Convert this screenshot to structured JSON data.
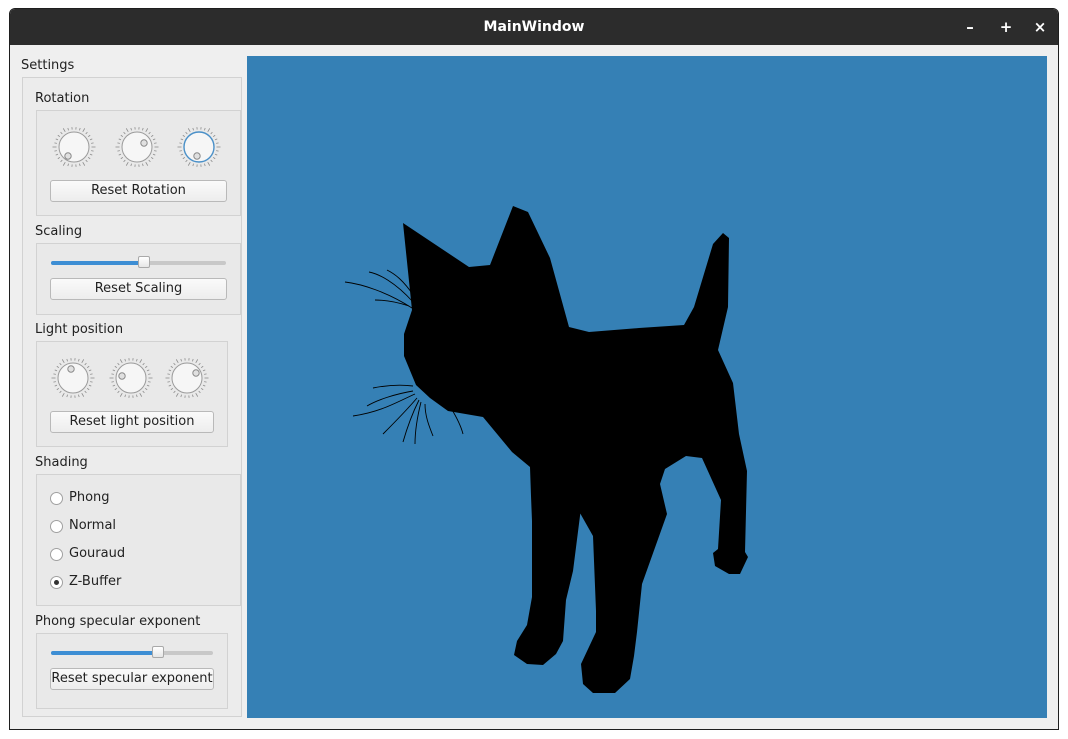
{
  "window": {
    "title": "MainWindow",
    "minimize": "–",
    "maximize": "+",
    "close": "×"
  },
  "settings": {
    "title": "Settings",
    "rotation": {
      "title": "Rotation",
      "reset_label": "Reset Rotation"
    },
    "scaling": {
      "title": "Scaling",
      "reset_label": "Reset Scaling",
      "value_fraction": 0.53
    },
    "light": {
      "title": "Light position",
      "reset_label": "Reset light position"
    },
    "shading": {
      "title": "Shading",
      "options": [
        {
          "label": "Phong",
          "checked": false
        },
        {
          "label": "Normal",
          "checked": false
        },
        {
          "label": "Gouraud",
          "checked": false
        },
        {
          "label": "Z-Buffer",
          "checked": true
        }
      ]
    },
    "specular": {
      "title": "Phong specular exponent",
      "reset_label": "Reset specular exponent",
      "value_fraction": 0.66
    }
  },
  "viewport": {
    "background": "#3580b5",
    "model_color": "#000000",
    "model": "cat-silhouette"
  }
}
